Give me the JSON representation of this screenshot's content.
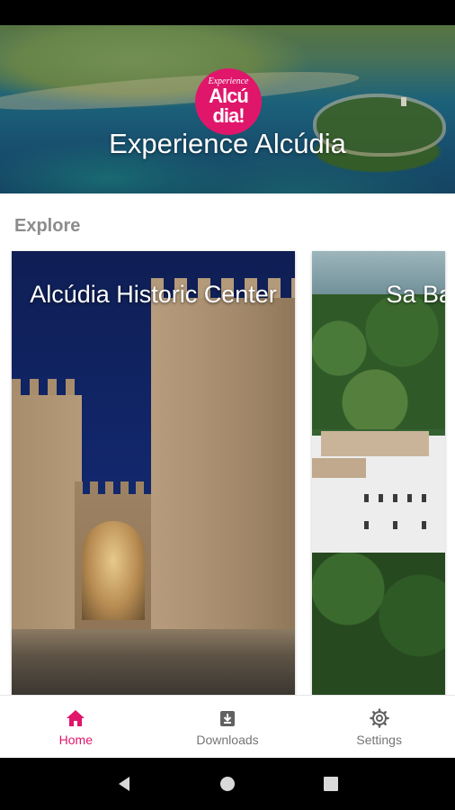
{
  "header": {
    "title": "Experience Alcúdia",
    "logo": {
      "line1": "Experience",
      "line2": "Alcú",
      "line3": "dia!",
      "color": "#e0166b"
    }
  },
  "explore": {
    "label": "Explore",
    "cards": [
      {
        "title": "Alcúdia Historic Center"
      },
      {
        "title": "Sa Bass Mus"
      }
    ]
  },
  "bottom_nav": {
    "items": [
      {
        "label": "Home",
        "icon": "home-icon",
        "active": true
      },
      {
        "label": "Downloads",
        "icon": "download-icon",
        "active": false
      },
      {
        "label": "Settings",
        "icon": "settings-icon",
        "active": false
      }
    ],
    "active_color": "#e0166b",
    "inactive_color": "#757575"
  },
  "system_nav": {
    "icons": [
      "back-icon",
      "home-circle-icon",
      "recents-icon"
    ]
  }
}
